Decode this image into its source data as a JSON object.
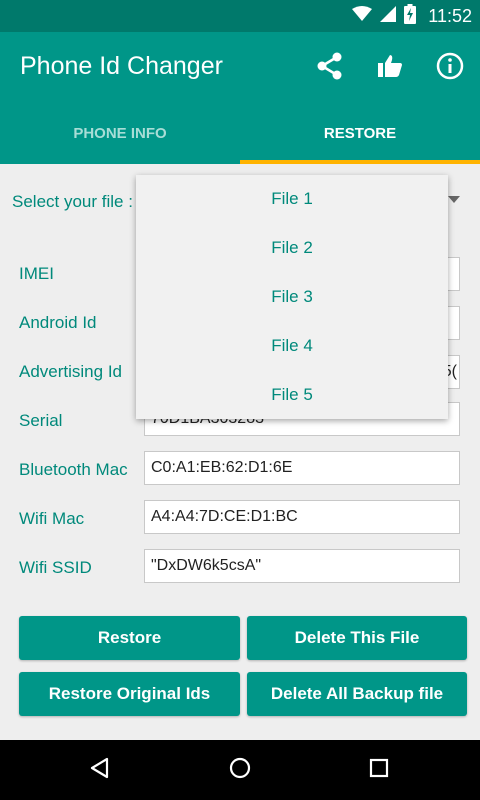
{
  "status_bar": {
    "time": "11:52"
  },
  "app_bar": {
    "title": "Phone Id Changer"
  },
  "tabs": [
    {
      "label": "PHONE INFO"
    },
    {
      "label": "RESTORE"
    }
  ],
  "restore": {
    "select_label": "Select your file :",
    "rows": [
      {
        "label": "IMEI",
        "value": ""
      },
      {
        "label": "Android Id",
        "value": ""
      },
      {
        "label": "Advertising Id",
        "value": "5("
      },
      {
        "label": "Serial",
        "value": "70D1BA303283"
      },
      {
        "label": "Bluetooth Mac",
        "value": "C0:A1:EB:62:D1:6E"
      },
      {
        "label": "Wifi Mac",
        "value": "A4:A4:7D:CE:D1:BC"
      },
      {
        "label": "Wifi SSID",
        "value": "\"DxDW6k5csA\""
      }
    ],
    "buttons": {
      "restore": "Restore",
      "delete_this_file": "Delete This File",
      "restore_original_ids": "Restore Original Ids",
      "delete_all_backup": "Delete All Backup file"
    }
  },
  "dropdown": {
    "options": [
      "File 1",
      "File 2",
      "File 3",
      "File 4",
      "File 5"
    ]
  },
  "colors": {
    "primary": "#009688",
    "primary_dark": "#00796b",
    "accent": "#ffb300",
    "label_text": "#00897b"
  }
}
